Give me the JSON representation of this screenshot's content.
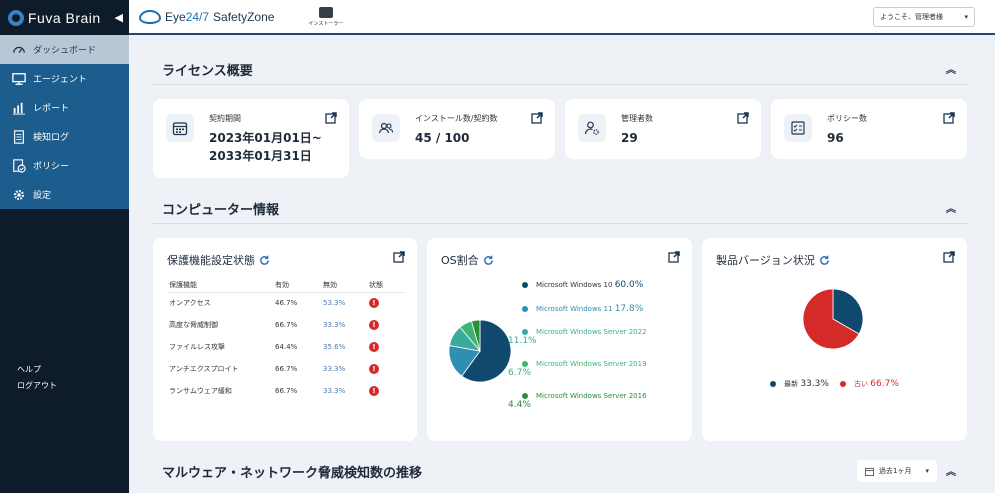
{
  "sidebar": {
    "brand": "Fuva Brain",
    "items": [
      {
        "label": "ダッシュボード"
      },
      {
        "label": "エージェント"
      },
      {
        "label": "レポート"
      },
      {
        "label": "検知ログ"
      },
      {
        "label": "ポリシー"
      },
      {
        "label": "設定"
      }
    ],
    "bottom": [
      {
        "label": "ヘルプ"
      },
      {
        "label": "ログアウト"
      }
    ]
  },
  "topbar": {
    "product_eye": "Eye",
    "product_247": "24/7",
    "product_name": "SafetyZone",
    "installer_label": "インストーラー",
    "user_greeting": "ようこそ、管理者様"
  },
  "license": {
    "title": "ライセンス概要",
    "cards": [
      {
        "label": "契約期間",
        "value_line1": "2023年01月01日~",
        "value_line2": "2033年01月31日"
      },
      {
        "label": "インストール数/契約数",
        "value": "45 / 100"
      },
      {
        "label": "管理者数",
        "value": "29"
      },
      {
        "label": "ポリシー数",
        "value": "96"
      }
    ]
  },
  "computer": {
    "title": "コンピューター情報",
    "protection": {
      "title": "保護機能設定状態",
      "headers": [
        "保護機能",
        "有効",
        "無効",
        "状態"
      ],
      "rows": [
        {
          "name": "オンアクセス",
          "enabled": "46.7%",
          "disabled": "53.3%",
          "status": "!"
        },
        {
          "name": "高度な脅威制御",
          "enabled": "66.7%",
          "disabled": "33.3%",
          "status": "!"
        },
        {
          "name": "ファイルレス攻撃",
          "enabled": "64.4%",
          "disabled": "35.6%",
          "status": "!"
        },
        {
          "name": "アンチエクスプロイト",
          "enabled": "66.7%",
          "disabled": "33.3%",
          "status": "!"
        },
        {
          "name": "ランサムウェア緩和",
          "enabled": "66.7%",
          "disabled": "33.3%",
          "status": "!"
        }
      ]
    },
    "os": {
      "title": "OS割合",
      "legend": [
        {
          "name": "Microsoft Windows 10",
          "pct": "60.0%",
          "color": "#0f4a6e"
        },
        {
          "name": "Microsoft Windows 11",
          "pct": "17.8%",
          "color": "#2e8fb0"
        },
        {
          "name": "Microsoft Windows Server 2022",
          "pct": "11.1%",
          "color": "#3aaa9a"
        },
        {
          "name": "Microsoft Windows Server 2019",
          "pct": "6.7%",
          "color": "#3db374"
        },
        {
          "name": "Microsoft Windows Server 2016",
          "pct": "4.4%",
          "color": "#2a8f3a"
        }
      ]
    },
    "version": {
      "title": "製品バージョン状況",
      "legend": [
        {
          "name": "最新",
          "pct": "33.3%",
          "color": "#0f4a6e"
        },
        {
          "name": "古い",
          "pct": "66.7%",
          "color": "#d42a2a"
        }
      ]
    }
  },
  "malware": {
    "title": "マルウェア・ネットワーク脅威検知数の推移",
    "period": "過去1ヶ月"
  },
  "chart_data": [
    {
      "type": "pie",
      "title": "OS割合",
      "categories": [
        "Microsoft Windows 10",
        "Microsoft Windows 11",
        "Microsoft Windows Server 2022",
        "Microsoft Windows Server 2019",
        "Microsoft Windows Server 2016"
      ],
      "values": [
        60.0,
        17.8,
        11.1,
        6.7,
        4.4
      ],
      "colors": [
        "#0f4a6e",
        "#2e8fb0",
        "#3aaa9a",
        "#3db374",
        "#2a8f3a"
      ],
      "legend": "right"
    },
    {
      "type": "pie",
      "title": "製品バージョン状況",
      "categories": [
        "最新",
        "古い"
      ],
      "values": [
        33.3,
        66.7
      ],
      "colors": [
        "#0f4a6e",
        "#d42a2a"
      ],
      "legend": "bottom"
    }
  ]
}
